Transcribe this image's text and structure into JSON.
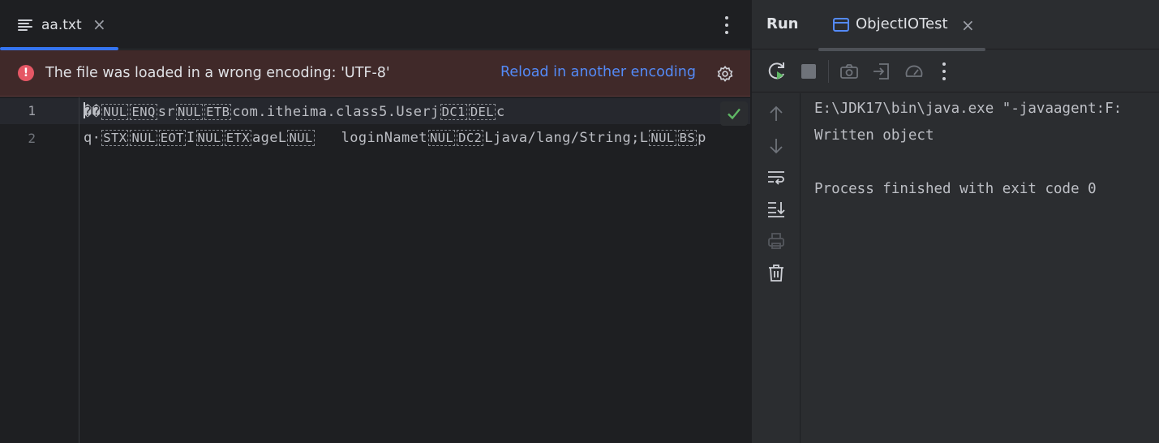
{
  "editor": {
    "tab": {
      "filename": "aa.txt",
      "close": "×"
    },
    "banner": {
      "message": "The file was loaded in a wrong encoding: 'UTF-8'",
      "action": "Reload in another encoding"
    },
    "lines": [
      {
        "number": "1",
        "segments": [
          "��",
          "NUL",
          "ENQ",
          "sr",
          "NUL",
          "ETB",
          "com.itheima.class5.Userj",
          "DC1",
          "DEL",
          "c"
        ]
      },
      {
        "number": "2",
        "segments": [
          "q·",
          "STX",
          "NUL",
          "EOT",
          "I",
          "NUL",
          "ETX",
          "ageL",
          "NUL",
          "   loginNamet",
          "NUL",
          "DC2",
          "Ljava/lang/String;L",
          "NUL",
          "BS",
          "p"
        ]
      }
    ]
  },
  "run": {
    "title": "Run",
    "tab": {
      "name": "ObjectIOTest",
      "close": "×"
    },
    "console": [
      "E:\\JDK17\\bin\\java.exe \"-javaagent:F:",
      "Written object",
      "",
      "Process finished with exit code 0"
    ]
  },
  "colors": {
    "accent": "#3574f0",
    "link": "#548af7",
    "error": "#e55765",
    "banner_bg": "#402929",
    "success": "#5fb865"
  },
  "icons": {
    "toolbar": [
      "rerun-icon",
      "stop-icon",
      "camera-icon",
      "restore-layout-icon",
      "profiler-icon",
      "more-icon"
    ],
    "side": [
      "arrow-up-icon",
      "arrow-down-icon",
      "soft-wrap-icon",
      "scroll-to-end-icon",
      "print-icon",
      "trash-icon"
    ]
  }
}
